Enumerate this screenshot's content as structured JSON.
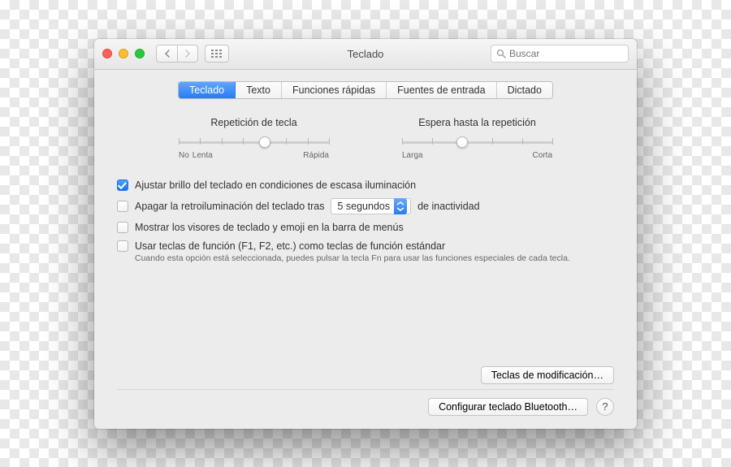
{
  "window": {
    "title": "Teclado"
  },
  "search": {
    "placeholder": "Buscar"
  },
  "tabs": [
    {
      "label": "Teclado",
      "selected": true
    },
    {
      "label": "Texto"
    },
    {
      "label": "Funciones rápidas"
    },
    {
      "label": "Fuentes de entrada"
    },
    {
      "label": "Dictado"
    }
  ],
  "sliders": {
    "key_repeat": {
      "label": "Repetición de tecla",
      "min_caption": "No",
      "mid_caption": "Lenta",
      "max_caption": "Rápida",
      "ticks": 8,
      "value_index": 4
    },
    "delay_repeat": {
      "label": "Espera hasta la repetición",
      "min_caption": "Larga",
      "max_caption": "Corta",
      "ticks": 6,
      "value_index": 2
    }
  },
  "options": {
    "auto_brightness": {
      "checked": true,
      "label": "Ajustar brillo del teclado en condiciones de escasa iluminación"
    },
    "backlight_off": {
      "checked": false,
      "prefix": "Apagar la retroiluminación del teclado tras",
      "select_value": "5 segundos",
      "suffix": "de inactividad"
    },
    "show_viewers": {
      "checked": false,
      "label": "Mostrar los visores de teclado y emoji en la barra de menús"
    },
    "fn_keys": {
      "checked": false,
      "label": "Usar teclas de función (F1, F2, etc.) como teclas de función estándar",
      "hint": "Cuando esta opción está seleccionada, puedes pulsar la tecla Fn para usar las funciones especiales de cada tecla."
    }
  },
  "buttons": {
    "modifier": "Teclas de modificación…",
    "bluetooth": "Configurar teclado Bluetooth…"
  }
}
